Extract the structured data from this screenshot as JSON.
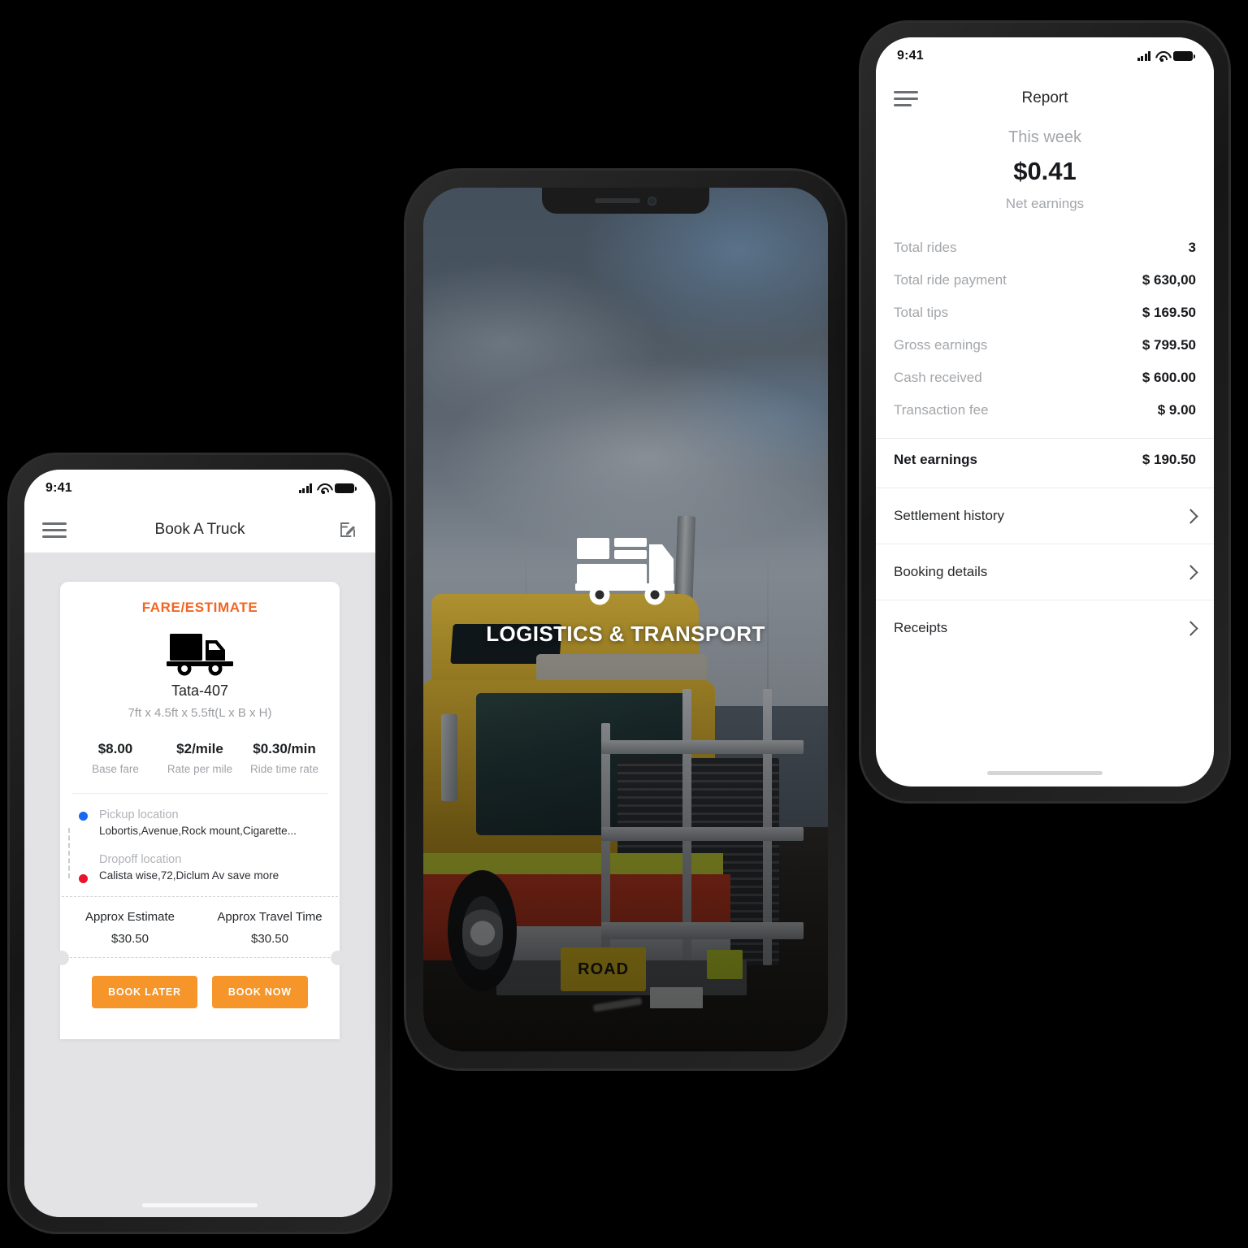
{
  "theme": {
    "accent": "#f26522",
    "button": "#f5952a",
    "dot_pickup": "#1669f2",
    "dot_dropoff": "#e8142c"
  },
  "booking_phone": {
    "status": {
      "time": "9:41",
      "signal_icon": "signal-bars-icon",
      "wifi_icon": "wifi-icon",
      "battery_icon": "battery-icon"
    },
    "nav": {
      "menu_icon": "hamburger-menu-icon",
      "title": "Book A Truck",
      "edit_icon": "edit-compose-icon"
    },
    "card": {
      "heading": "FARE/ESTIMATE",
      "vehicle_icon": "delivery-truck-icon",
      "vehicle_name": "Tata-407",
      "vehicle_dimensions": "7ft x 4.5ft x 5.5ft(L x B x H)",
      "rates": [
        {
          "value": "$8.00",
          "label": "Base fare"
        },
        {
          "value": "$2/mile",
          "label": "Rate per mile"
        },
        {
          "value": "$0.30/min",
          "label": "Ride time rate"
        }
      ],
      "pickup": {
        "label": "Pickup location",
        "value": "Lobortis,Avenue,Rock mount,Cigarette..."
      },
      "dropoff": {
        "label": "Dropoff location",
        "value": "Calista wise,72,Diclum Av save more"
      },
      "approx": [
        {
          "title": "Approx Estimate",
          "value": "$30.50"
        },
        {
          "title": "Approx Travel Time",
          "value": "$30.50"
        }
      ],
      "buttons": {
        "later": "BOOK LATER",
        "now": "BOOK NOW"
      }
    }
  },
  "splash_phone": {
    "logo_icon": "truck-logo-icon",
    "brand": "LOGISTICS & TRANSPORT",
    "photo": {
      "plate_text": "ROAD",
      "alt": "yellow and red semi truck on road under cloudy sky"
    }
  },
  "report_phone": {
    "status": {
      "time": "9:41",
      "signal_icon": "signal-bars-icon",
      "wifi_icon": "wifi-icon",
      "battery_icon": "battery-icon"
    },
    "nav": {
      "menu_icon": "hamburger-menu-icon",
      "title": "Report"
    },
    "summary": {
      "period": "This week",
      "amount": "$0.41",
      "caption": "Net earnings"
    },
    "rows": [
      {
        "key": "Total rides",
        "value": "3"
      },
      {
        "key": "Total ride payment",
        "value": "$ 630,00"
      },
      {
        "key": "Total tips",
        "value": "$ 169.50"
      },
      {
        "key": "Gross earnings",
        "value": "$ 799.50"
      },
      {
        "key": "Cash received",
        "value": "$ 600.00"
      },
      {
        "key": "Transaction fee",
        "value": "$ 9.00"
      }
    ],
    "net": {
      "key": "Net earnings",
      "value": "$ 190.50"
    },
    "links": [
      {
        "label": "Settlement history",
        "icon": "chevron-right-icon"
      },
      {
        "label": "Booking details",
        "icon": "chevron-right-icon"
      },
      {
        "label": "Receipts",
        "icon": "chevron-right-icon"
      }
    ]
  }
}
